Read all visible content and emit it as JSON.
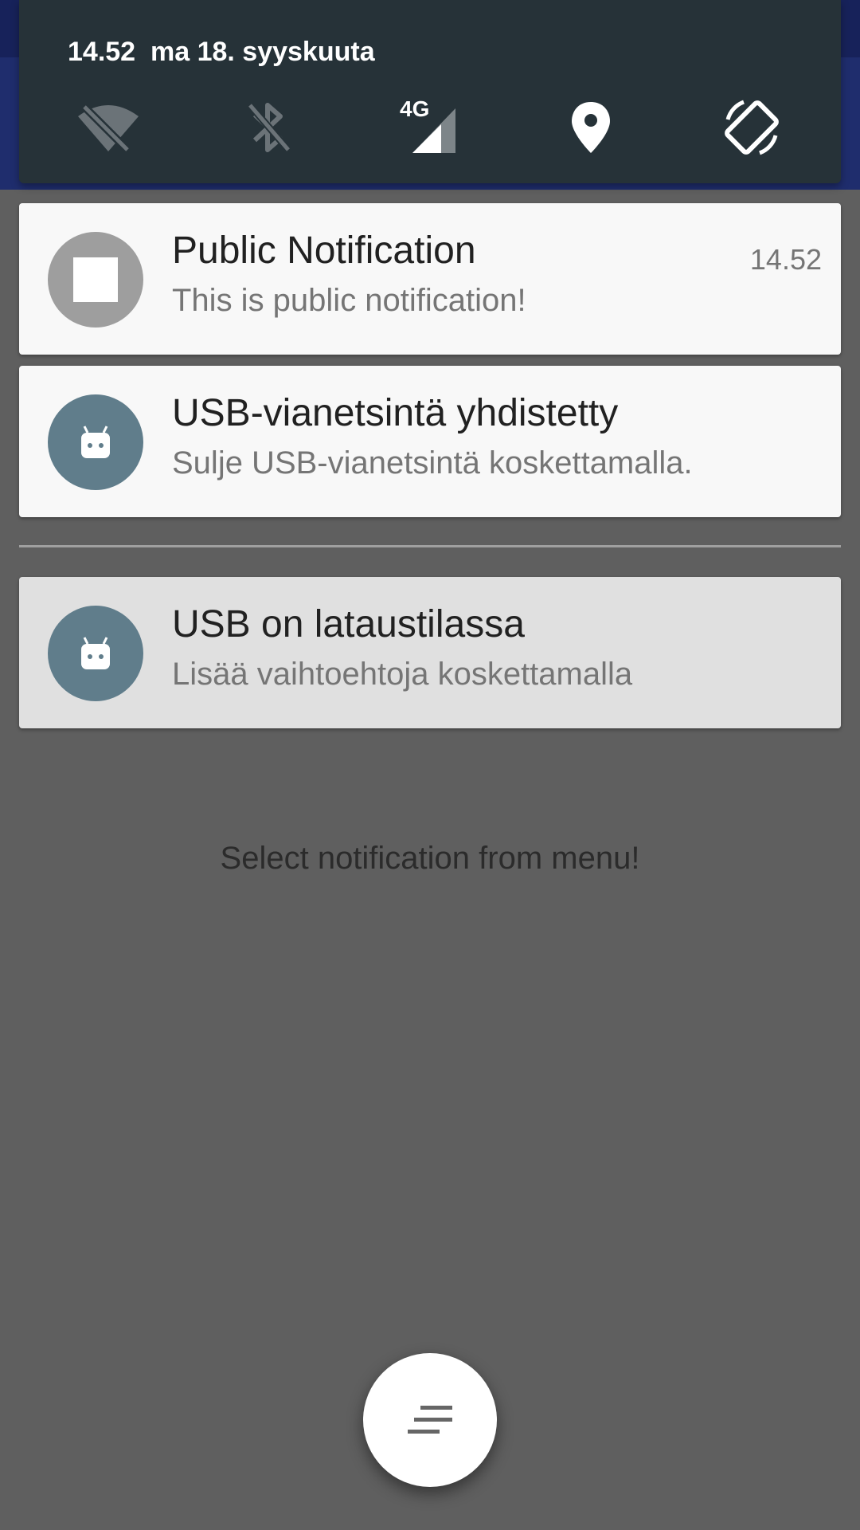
{
  "quick_settings": {
    "time": "14.52",
    "date": "ma 18. syyskuuta",
    "tiles": [
      {
        "name": "wifi-off-icon",
        "active": false
      },
      {
        "name": "bluetooth-off-icon",
        "active": false
      },
      {
        "name": "mobile-data-icon",
        "label": "4G",
        "active": true
      },
      {
        "name": "location-icon",
        "active": true
      },
      {
        "name": "auto-rotate-icon",
        "active": true
      }
    ]
  },
  "notifications": [
    {
      "title": "Public Notification",
      "text": "This is public notification!",
      "time": "14.52",
      "icon": "stop-square-icon",
      "icon_color": "#9e9e9e"
    },
    {
      "title": "USB-vianetsintä yhdistetty",
      "text": "Sulje USB-vianetsintä koskettamalla.",
      "icon": "android-icon",
      "icon_color": "#607d8b"
    },
    {
      "title": "USB on lataustilassa",
      "text": "Lisää vaihtoehtoja koskettamalla",
      "icon": "android-icon",
      "icon_color": "#607d8b"
    }
  ],
  "app": {
    "message": "Select notification from menu!",
    "fab_icon": "menu-lines-icon"
  },
  "colors": {
    "qs_background": "#263238",
    "scrim": "#5f5f5f",
    "app_primary": "#1f2d6d"
  }
}
